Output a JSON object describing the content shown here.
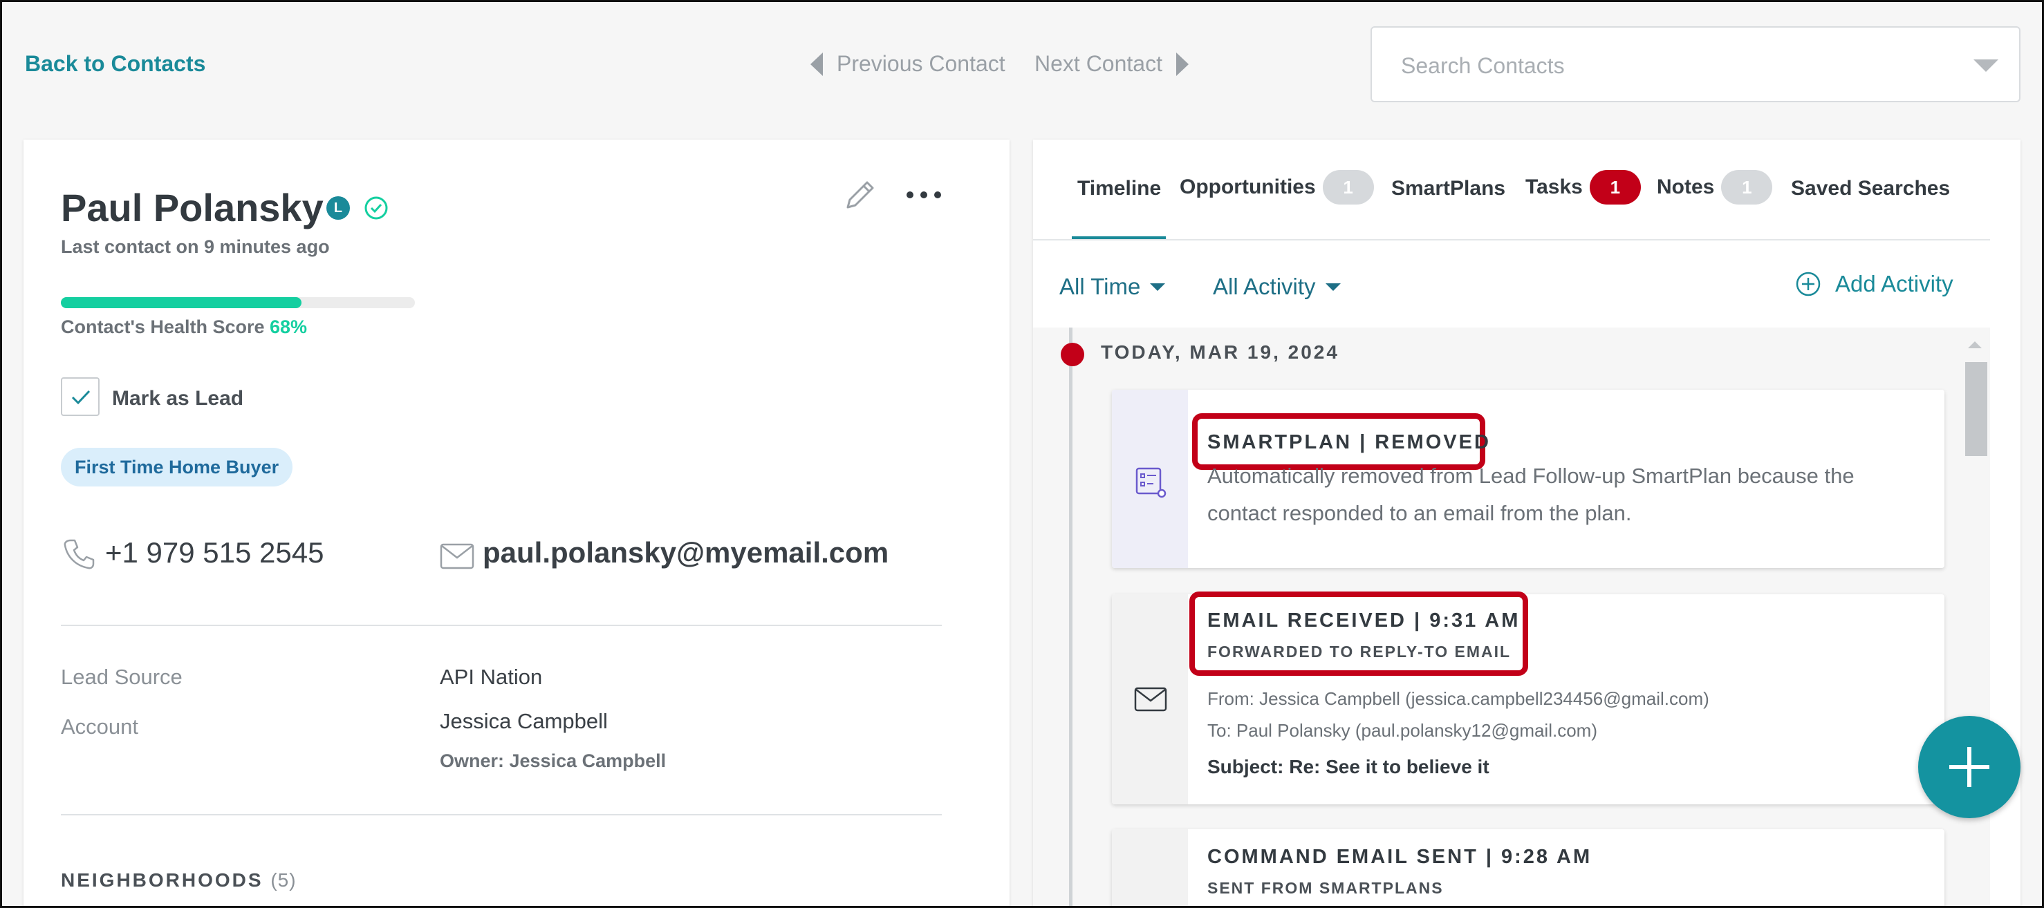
{
  "topbar": {
    "back_label": "Back to Contacts",
    "prev_label": "Previous Contact",
    "next_label": "Next Contact",
    "search_placeholder": "Search Contacts"
  },
  "contact": {
    "name": "Paul Polansky",
    "lead_badge": "L",
    "last_contact": "Last contact on 9 minutes ago",
    "health_label": "Contact's Health Score",
    "health_pct": "68%",
    "health_value": 0.68,
    "mark_as_lead_label": "Mark as Lead",
    "mark_as_lead_checked": true,
    "tag": "First Time Home Buyer",
    "phone": "+1 979 515 2545",
    "email": "paul.polansky@myemail.com",
    "fields": [
      {
        "label": "Lead Source",
        "value": "API Nation"
      },
      {
        "label": "Account",
        "value": "Jessica Campbell"
      }
    ],
    "owner": "Owner: Jessica Campbell",
    "neighborhoods_label": "NEIGHBORHOODS",
    "neighborhoods_count": "(5)"
  },
  "tabs": [
    {
      "label": "Timeline",
      "count": null,
      "active": true
    },
    {
      "label": "Opportunities",
      "count": "1"
    },
    {
      "label": "SmartPlans",
      "count": null
    },
    {
      "label": "Tasks",
      "count": "1"
    },
    {
      "label": "Notes",
      "count": "1"
    },
    {
      "label": "Saved Searches",
      "count": null
    }
  ],
  "filters": {
    "time": "All Time",
    "activity": "All Activity",
    "add_activity": "Add Activity"
  },
  "timeline": {
    "date": "TODAY, MAR 19, 2024",
    "activities": [
      {
        "title": "SMARTPLAN | REMOVED",
        "body_line1": "Automatically removed from Lead Follow-up SmartPlan because the",
        "body_line2": "contact responded to an email from the plan."
      },
      {
        "title": "EMAIL RECEIVED | 9:31 AM",
        "subtitle": "FORWARDED TO REPLY-TO EMAIL",
        "from": "From: Jessica Campbell (jessica.campbell234456@gmail.com)",
        "to": "To: Paul Polansky (paul.polansky12@gmail.com)",
        "subject": "Subject: Re: See it to believe it"
      },
      {
        "title": "COMMAND EMAIL SENT | 9:28 AM",
        "subtitle": "SENT FROM SMARTPLANS"
      }
    ]
  },
  "colors": {
    "accent": "#1a8a99",
    "health": "#14cfa0",
    "alert": "#c20018"
  }
}
